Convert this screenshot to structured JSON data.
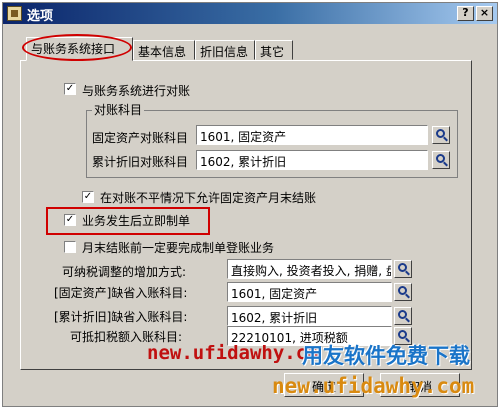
{
  "window": {
    "title": "选项",
    "help_label": "?",
    "close_label": "×"
  },
  "tabs": [
    {
      "label": "与账务系统接口",
      "active": true
    },
    {
      "label": "基本信息"
    },
    {
      "label": "折旧信息"
    },
    {
      "label": "其它"
    }
  ],
  "reconcile": {
    "checked": true,
    "label": "与账务系统进行对账"
  },
  "group": {
    "title": "对账科目",
    "fixed_asset": {
      "label": "固定资产对账科目",
      "value": "1601, 固定资产"
    },
    "accum_dep": {
      "label": "累计折旧对账科目",
      "value": "1602, 累计折旧"
    }
  },
  "allow_close": {
    "checked": true,
    "label": "在对账不平情况下允许固定资产月末结账"
  },
  "immediate": {
    "checked": true,
    "label": "业务发生后立即制单"
  },
  "month_end": {
    "checked": false,
    "label": "月末结账前一定要完成制单登账业务"
  },
  "fields": [
    {
      "label": "可纳税调整的增加方式:",
      "value": "直接购入, 投资者投入, 捐赠, 盘"
    },
    {
      "label": "[固定资产]缺省入账科目:",
      "value": "1601, 固定资产"
    },
    {
      "label": "[累计折旧]缺省入账科目:",
      "value": "1602, 累计折旧"
    },
    {
      "label": "可抵扣税额入账科目:",
      "value": "22210101, 进项税额"
    }
  ],
  "buttons": {
    "ok": "确定",
    "cancel": "取消"
  },
  "watermark": {
    "url_left": "new.ufidawhy.co",
    "slogan": "用友软件免费下载",
    "url_right": "new.ufidawhy.com"
  }
}
